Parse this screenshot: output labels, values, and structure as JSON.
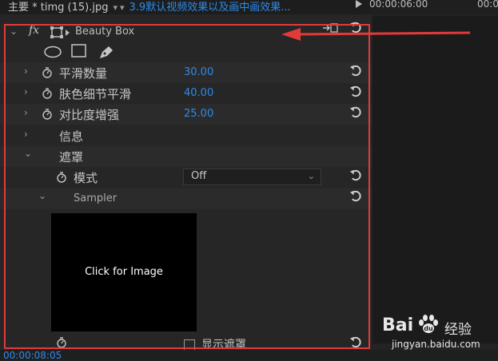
{
  "header": {
    "main_tab": "主要 * timg (15).jpg",
    "sequence_tab": "3.9默认视频效果以及画中画效果...",
    "timecode_start": "00:00:06:00",
    "timecode_end": "00:00"
  },
  "effect": {
    "fx_label": "fx",
    "name": "Beauty Box",
    "mask_tools": [
      "ellipse-mask-icon",
      "rectangle-mask-icon",
      "pen-mask-icon"
    ]
  },
  "params": [
    {
      "label": "平滑数量",
      "value": "30.00"
    },
    {
      "label": "肤色细节平滑",
      "value": "40.00"
    },
    {
      "label": "对比度增强",
      "value": "25.00"
    }
  ],
  "groups": {
    "info": "信息",
    "mask": "遮罩",
    "mode_label": "模式",
    "mode_value": "Off",
    "sampler_label": "Sampler",
    "sampler_button": "Click for Image",
    "show_mask": "显示遮罩"
  },
  "footer": {
    "timecode": "00:00:08:05"
  },
  "annotation": {
    "highlight_color": "#e23a3a"
  },
  "watermark": {
    "brand_bai": "Bai",
    "brand_du_icon": "paw-icon",
    "brand_jingyan": "经验",
    "url": "jingyan.baidu.com"
  },
  "colors": {
    "accent": "#2d8ceb",
    "panel_bg": "#262626"
  }
}
